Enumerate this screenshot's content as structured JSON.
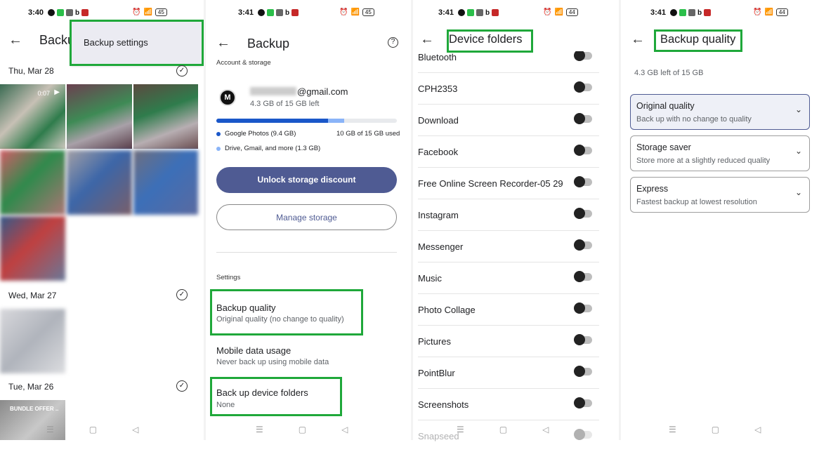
{
  "panel1": {
    "time": "3:40",
    "battery": "45",
    "title": "Backup",
    "popup_label": "Backup settings",
    "dates": [
      "Thu, Mar 28",
      "Wed, Mar 27",
      "Tue, Mar 26"
    ],
    "video_duration": "0:07",
    "banner_text": "BUNDLE OFFER .."
  },
  "panel2": {
    "time": "3:41",
    "battery": "45",
    "title": "Backup",
    "account_section": "Account & storage",
    "email_suffix": "@gmail.com",
    "storage_left": "4.3 GB of 15 GB left",
    "usage_fraction": 0.67,
    "legend_photos": "Google Photos (9.4 GB)",
    "legend_used": "10 GB of 15 GB used",
    "legend_drive": "Drive, Gmail, and more (1.3 GB)",
    "unlock_button": "Unlock storage discount",
    "manage_button": "Manage storage",
    "settings_section": "Settings",
    "settings": [
      {
        "title": "Backup quality",
        "subtitle": "Original quality (no change to quality)"
      },
      {
        "title": "Mobile data usage",
        "subtitle": "Never back up using mobile data"
      },
      {
        "title": "Back up device folders",
        "subtitle": "None"
      }
    ]
  },
  "panel3": {
    "time": "3:41",
    "battery": "44",
    "title": "Device folders",
    "folders": [
      "Bluetooth",
      "CPH2353",
      "Download",
      "Facebook",
      "Free Online Screen Recorder-05 29",
      "Instagram",
      "Messenger",
      "Music",
      "Photo Collage",
      "Pictures",
      "PointBlur",
      "Screenshots",
      "Snapseed"
    ]
  },
  "panel4": {
    "time": "3:41",
    "battery": "44",
    "title": "Backup quality",
    "storage_left": "4.3 GB left of 15 GB",
    "options": [
      {
        "title": "Original quality",
        "subtitle": "Back up with no change to quality",
        "selected": true
      },
      {
        "title": "Storage saver",
        "subtitle": "Store more at a slightly reduced quality",
        "selected": false
      },
      {
        "title": "Express",
        "subtitle": "Fastest backup at lowest resolution",
        "selected": false
      }
    ]
  },
  "icons": {
    "back": "←",
    "help": "?",
    "check": "✓",
    "chevron": "⌄",
    "play": "▶",
    "nav_menu": "☰",
    "nav_home": "▢",
    "nav_back": "◁"
  },
  "colors": {
    "highlight_green": "#1fa83a",
    "primary_button": "#4f5b93",
    "photos_blue": "#1a57c9",
    "drive_blue": "#8ab4f8"
  }
}
